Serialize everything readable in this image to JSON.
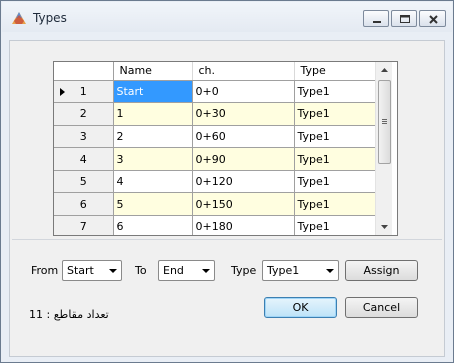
{
  "window": {
    "title": "Types"
  },
  "grid": {
    "columns": [
      "Name",
      "ch.",
      "Type"
    ],
    "rows": [
      {
        "num": "1",
        "name": "Start",
        "ch": "0+0",
        "type": "Type1"
      },
      {
        "num": "2",
        "name": "1",
        "ch": "0+30",
        "type": "Type1"
      },
      {
        "num": "3",
        "name": "2",
        "ch": "0+60",
        "type": "Type1"
      },
      {
        "num": "4",
        "name": "3",
        "ch": "0+90",
        "type": "Type1"
      },
      {
        "num": "5",
        "name": "4",
        "ch": "0+120",
        "type": "Type1"
      },
      {
        "num": "6",
        "name": "5",
        "ch": "0+150",
        "type": "Type1"
      },
      {
        "num": "7",
        "name": "6",
        "ch": "0+180",
        "type": "Type1"
      }
    ]
  },
  "controls": {
    "from_label": "From",
    "from_value": "Start",
    "to_label": "To",
    "to_value": "End",
    "type_label": "Type",
    "type_value": "Type1",
    "assign_label": "Assign",
    "ok_label": "OK",
    "cancel_label": "Cancel"
  },
  "status": {
    "count": "11",
    "count_label": ": تعداد مقاطع"
  }
}
